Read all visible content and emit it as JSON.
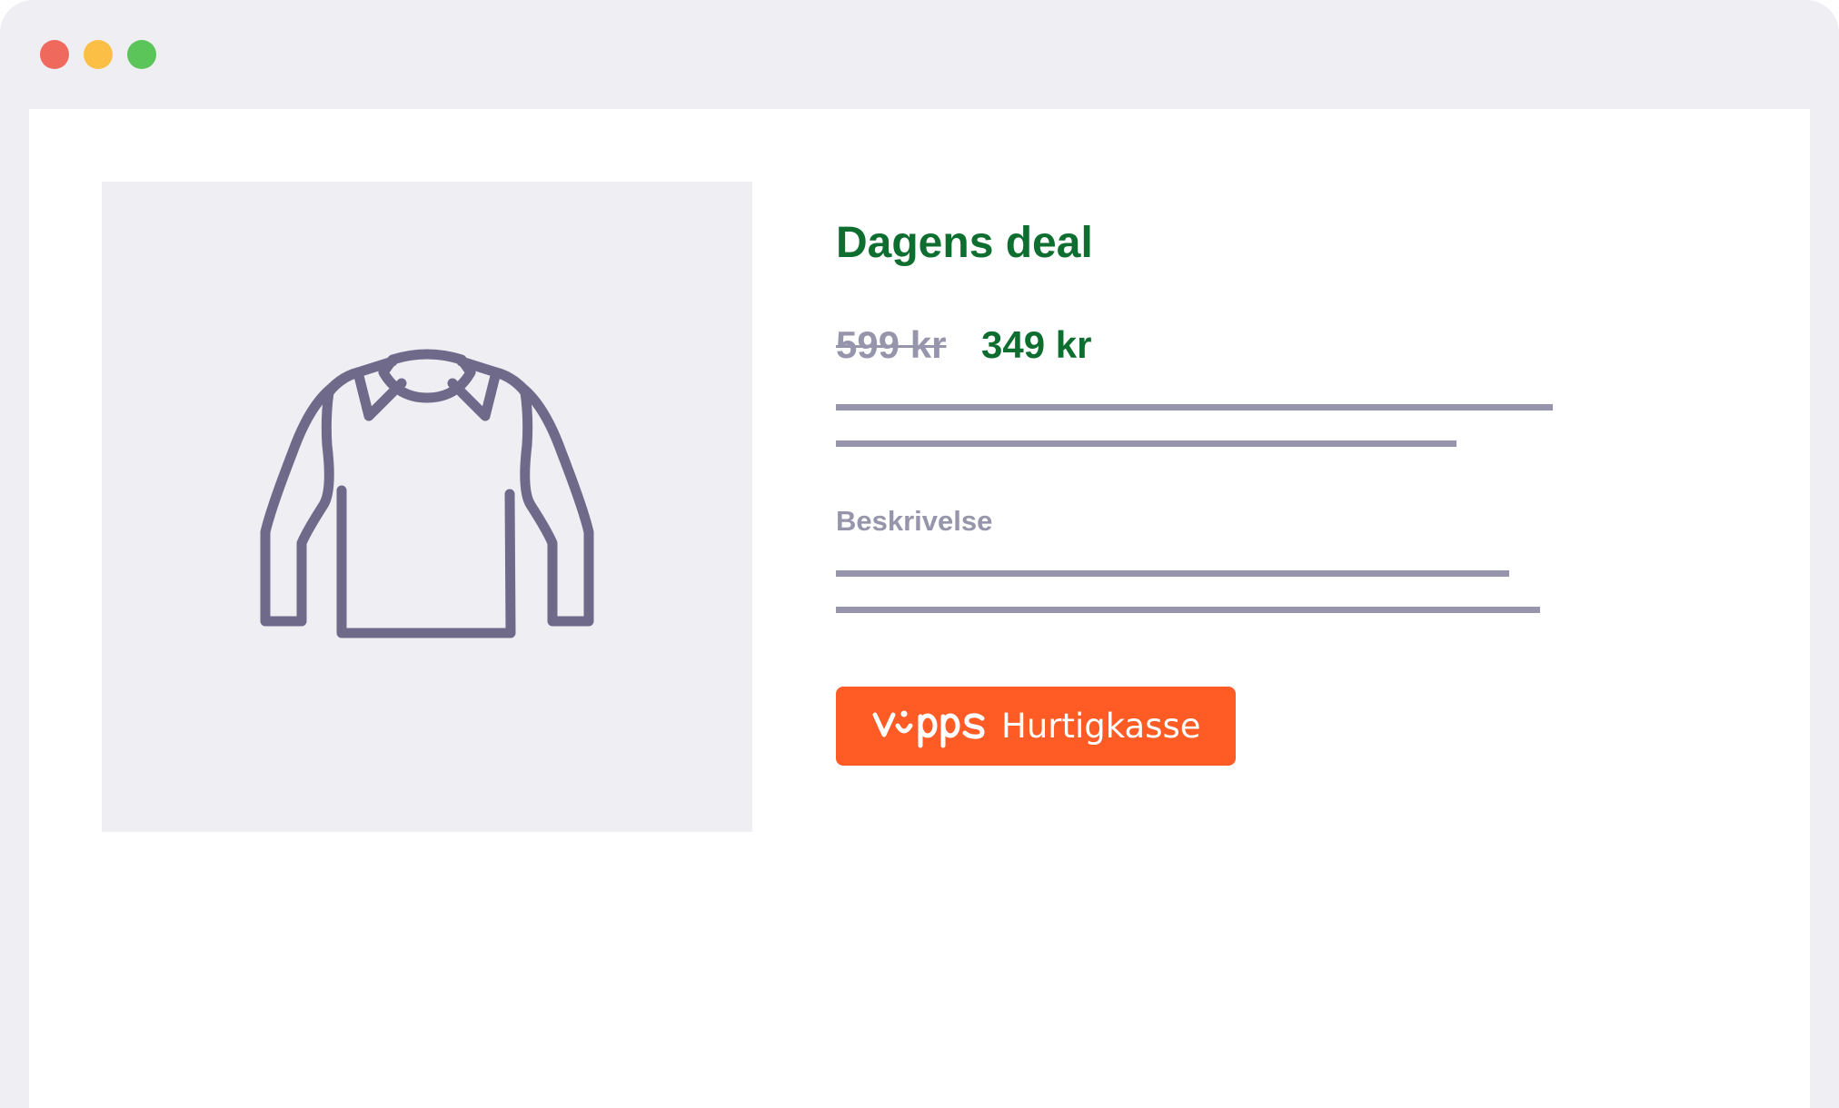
{
  "window": {
    "controls": [
      "close",
      "minimize",
      "maximize"
    ]
  },
  "product": {
    "image_icon": "jacket-icon",
    "title": "Dagens deal",
    "price_old": "599 kr",
    "price_new": "349 kr",
    "description_label": "Beskrivelse"
  },
  "checkout": {
    "brand": "vipps",
    "label": "Hurtigkasse"
  },
  "colors": {
    "accent_green": "#0e6e30",
    "muted_gray": "#9795ab",
    "vipps_orange": "#ff5b24",
    "icon_purple": "#6f6a8a"
  }
}
